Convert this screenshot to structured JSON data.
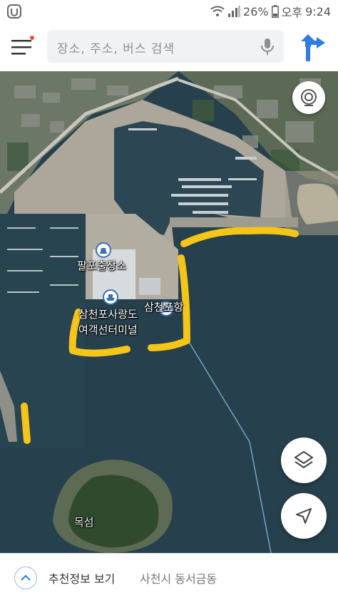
{
  "status_bar": {
    "battery": "26%",
    "ampm": "오후",
    "time": "9:24"
  },
  "search": {
    "placeholder": "장소, 주소, 버스 검색"
  },
  "map": {
    "labels": {
      "police": "팔포출장소",
      "terminal_line1": "삼천포사랑도",
      "terminal_line2": "여객선터미널",
      "port": "삼천포항",
      "island": "목섬"
    },
    "annotation_color": "#f5c518"
  },
  "bottom_bar": {
    "title": "추천정보 보기",
    "location": "사천시 동서금동"
  },
  "colors": {
    "accent": "#2f7de1",
    "notification_dot": "#e8532a",
    "sea": "#243f4c"
  }
}
